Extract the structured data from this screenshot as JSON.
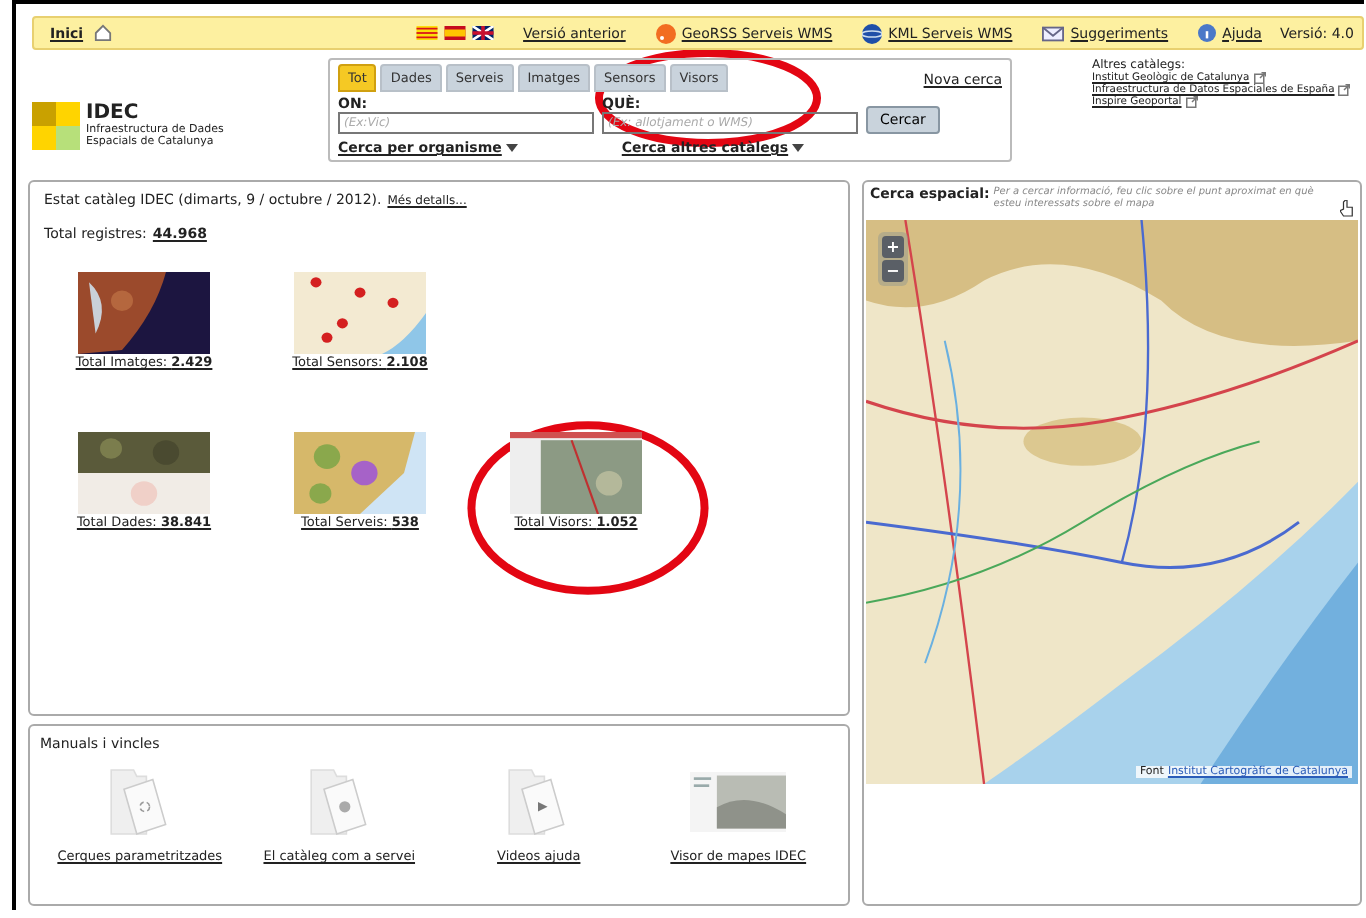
{
  "top_bar": {
    "home": "Inici",
    "version_link": "Versió anterior",
    "links": [
      {
        "text": "GeoRSS Serveis WMS",
        "kind": "rss"
      },
      {
        "text": "KML Serveis WMS",
        "kind": "kml"
      },
      {
        "text": "Suggeriments",
        "kind": "mail"
      },
      {
        "text": "Ajuda",
        "kind": "help"
      }
    ],
    "version": "Versió: 4.0"
  },
  "logo": {
    "name": "IDEC",
    "subtitle": "Infraestructura de Dades Espacials de Catalunya"
  },
  "search": {
    "tabs": [
      {
        "label": "Tot",
        "selected": true
      },
      {
        "label": "Dades",
        "selected": false
      },
      {
        "label": "Serveis",
        "selected": false
      },
      {
        "label": "Imatges",
        "selected": false
      },
      {
        "label": "Sensors",
        "selected": false
      },
      {
        "label": "Visors",
        "selected": false
      }
    ],
    "new_search": "Nova cerca",
    "where": {
      "label": "ON:",
      "placeholder": "(Ex:Vic)"
    },
    "what": {
      "label": "QUÈ:",
      "placeholder": "(Ex: allotjament o WMS)"
    },
    "button": "Cercar",
    "by_org": "Cerca per organisme",
    "other": "Cerca altres catàlegs"
  },
  "other_catalogs": {
    "title": "Altres catàlegs:",
    "links": [
      "Institut Geològic de Catalunya",
      "Infraestructura de Datos Espaciales de España",
      "Inspire Geoportal"
    ]
  },
  "catalog": {
    "status": "Estat catàleg IDEC (dimarts, 9 / octubre / 2012).",
    "details": "Més detalls...",
    "total_label": "Total registres:",
    "total": "44.968",
    "rows": [
      [
        {
          "label": "Total Imatges:",
          "count": "2.429"
        },
        {
          "label": "Total Sensors:",
          "count": "2.108"
        }
      ],
      [
        {
          "label": "Total Dades:",
          "count": "38.841"
        },
        {
          "label": "Total Serveis:",
          "count": "538"
        },
        {
          "label": "Total Visors:",
          "count": "1.052"
        }
      ]
    ]
  },
  "manuals": {
    "title": "Manuals i vincles",
    "items": [
      {
        "label": "Cerques parametritzades",
        "kind": "folder"
      },
      {
        "label": "El catàleg com a servei",
        "kind": "folder"
      },
      {
        "label": "Videos ajuda",
        "kind": "folder"
      },
      {
        "label": "Visor de mapes IDEC",
        "kind": "picture"
      }
    ]
  },
  "map": {
    "title": "Cerca espacial:",
    "hint": "Per a cercar informació, feu clic sobre el punt aproximat en què esteu interessats sobre el mapa",
    "zoom": [
      "+",
      "−"
    ],
    "source_label": "Font",
    "source": "Institut Cartogràfic de Catalunya"
  },
  "annotations": [
    {
      "kind": "ellipse",
      "color": "#e30613"
    },
    {
      "kind": "ellipse",
      "color": "#e30613"
    }
  ]
}
